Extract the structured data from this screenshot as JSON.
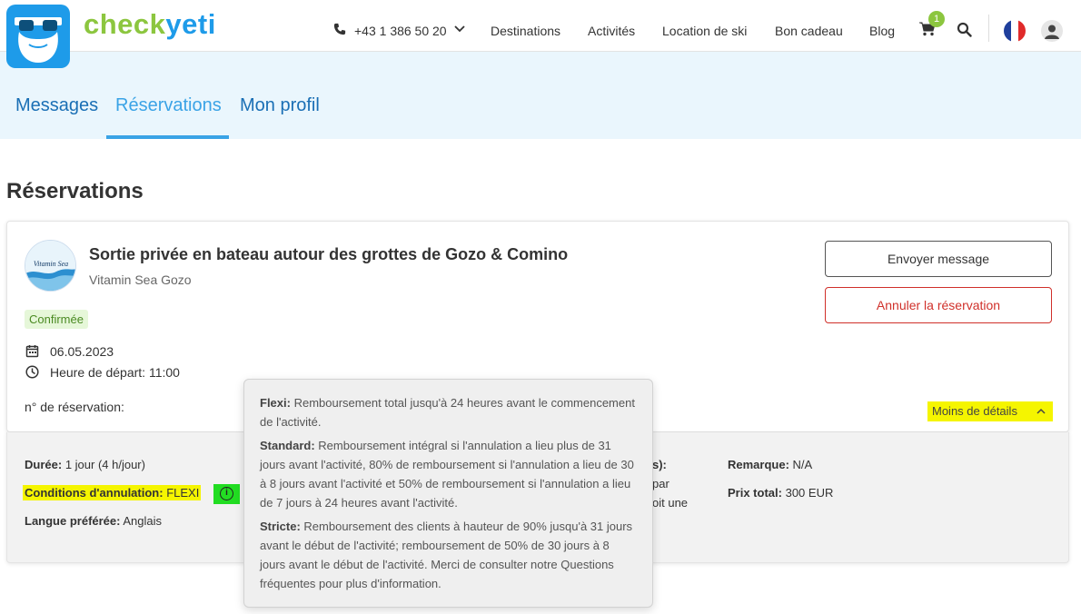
{
  "header": {
    "brand_part1": "check",
    "brand_part2": "yeti",
    "phone": "+43 1 386 50 20",
    "nav": [
      "Destinations",
      "Activités",
      "Location de ski",
      "Bon cadeau",
      "Blog"
    ],
    "cart_count": "1",
    "brand_green": "#8cc63f",
    "brand_blue": "#1e9be9"
  },
  "tabs": [
    {
      "label": "Messages",
      "active": false
    },
    {
      "label": "Réservations",
      "active": true
    },
    {
      "label": "Mon profil",
      "active": false
    }
  ],
  "page_title": "Réservations",
  "booking": {
    "title": "Sortie privée en bateau autour des grottes de Gozo & Comino",
    "vendor": "Vitamin Sea Gozo",
    "status": "Confirmée",
    "date": "06.05.2023",
    "departure": "Heure de départ: 11:00",
    "booking_no_label": "n° de réservation:",
    "send_message": "Envoyer message",
    "cancel": "Annuler la réservation",
    "less_details": "Moins de détails",
    "vendor_logo_text": "Vitamin Sea"
  },
  "details": {
    "duration_label": "Durée:",
    "duration_value": "1 jour (4 h/jour)",
    "cancel_cond_label": "Conditions d'annulation:",
    "cancel_cond_value": "FLEXI",
    "language_label": "Langue préférée:",
    "language_value": "Anglais",
    "remark_label": "Remarque:",
    "remark_value": "N/A",
    "total_label": "Prix total:",
    "total_value": "300 EUR",
    "partial_1": "s):",
    "partial_2": "par",
    "partial_3": "oit une"
  },
  "tooltip": {
    "flexi_label": "Flexi:",
    "flexi_text": "Remboursement total jusqu'à 24 heures avant le commencement de l'activité.",
    "standard_label": "Standard:",
    "standard_text": "Remboursement intégral si l'annulation a lieu plus de 31 jours avant l'activité, 80% de remboursement si l'annulation a lieu de 30 à 8 jours avant l'activité et 50% de remboursement si l'annulation a lieu de 7 jours à 24 heures avant l'activité.",
    "stricte_label": "Stricte:",
    "stricte_text": "Remboursement des clients à hauteur de 90% jusqu'à 31 jours avant le début de l'activité; remboursement de 50% de 30 jours à 8 jours avant le début de l'activité. Merci de consulter notre Questions fréquentes pour plus d'information."
  }
}
